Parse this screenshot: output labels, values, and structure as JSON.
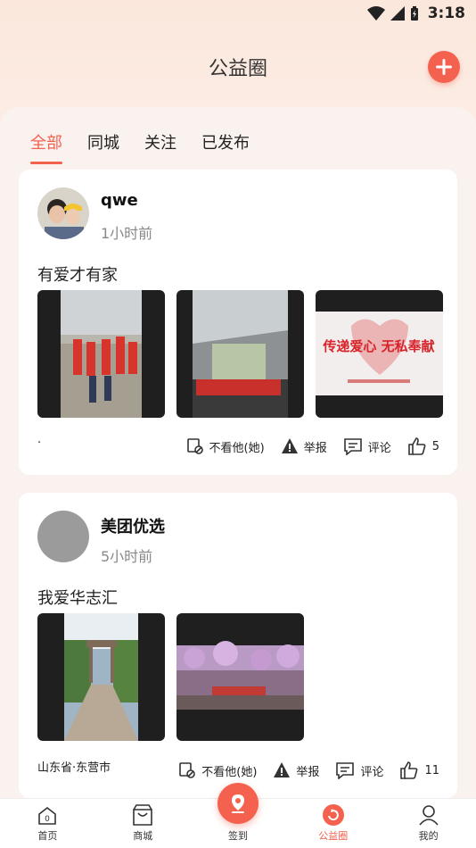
{
  "status_bar": {
    "time": "3:18"
  },
  "header": {
    "title": "公益圈"
  },
  "tabs": [
    {
      "label": "全部",
      "active": true
    },
    {
      "label": "同城",
      "active": false
    },
    {
      "label": "关注",
      "active": false
    },
    {
      "label": "已发布",
      "active": false
    }
  ],
  "posts": [
    {
      "user": "qwe",
      "time": "1小时前",
      "text": "有爱才有家",
      "location": ".",
      "actions": {
        "hide": "不看他(她)",
        "report": "举报",
        "comment": "评论",
        "likes": "5"
      },
      "banner_text": "传递爱心 无私奉献"
    },
    {
      "user": "美团优选",
      "time": "5小时前",
      "text": "我爱华志汇",
      "location": "山东省·东营市",
      "actions": {
        "hide": "不看他(她)",
        "report": "举报",
        "comment": "评论",
        "likes": "11"
      }
    }
  ],
  "bottom_nav": [
    {
      "label": "首页",
      "icon": "home-icon"
    },
    {
      "label": "商城",
      "icon": "shopping-bag-icon"
    },
    {
      "label": "签到",
      "icon": "location-pin-icon"
    },
    {
      "label": "公益圈",
      "icon": "circle-refresh-icon",
      "active": true
    },
    {
      "label": "我的",
      "icon": "user-icon"
    }
  ],
  "colors": {
    "accent": "#f4614f",
    "background": "#f9f2ef"
  }
}
